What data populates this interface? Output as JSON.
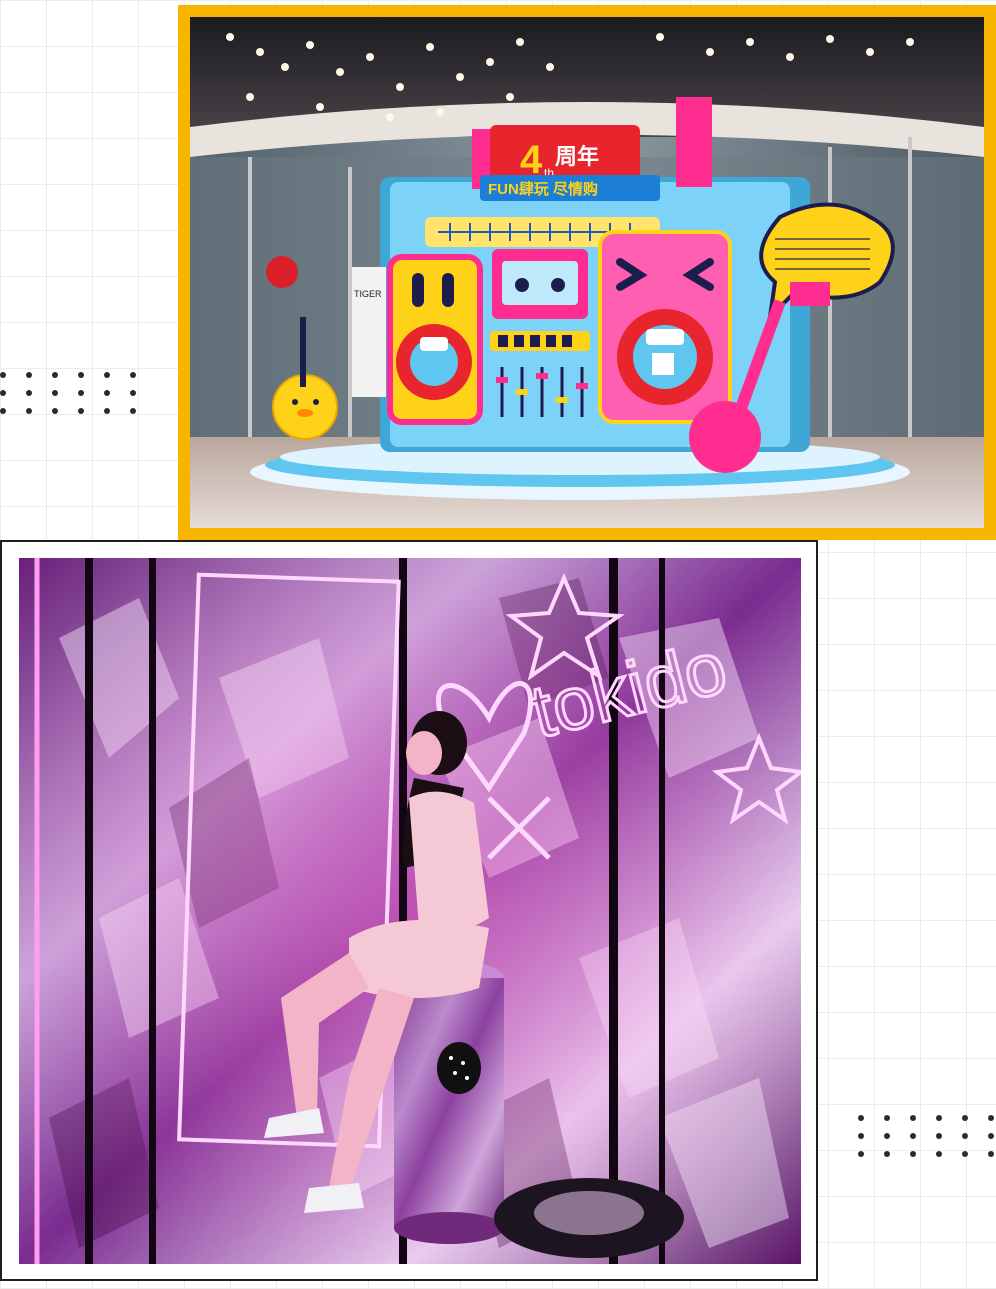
{
  "top_photo": {
    "banner_number": "4",
    "banner_sup": "th",
    "banner_text": "周年",
    "banner_sub": "FUN肆玩 尽情购",
    "store_sign": "TIGER",
    "colors": {
      "frame": "#f7b500",
      "pink": "#ff2d8f",
      "blue": "#5fc6ef",
      "yellow": "#ffd21a",
      "red": "#e8242c"
    }
  },
  "bottom_photo": {
    "neon_text": "tokido",
    "colors": {
      "neon": "#ffd7ff",
      "purple": "#8a1d8a",
      "pink": "#ff4fc8"
    }
  }
}
